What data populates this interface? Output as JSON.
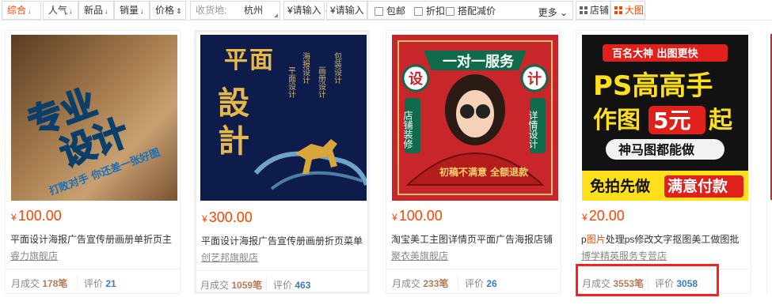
{
  "toolbar": {
    "sorts": [
      {
        "label": "综合",
        "arrow": "↓"
      },
      {
        "label": "人气",
        "arrow": "↓"
      },
      {
        "label": "新品",
        "arrow": "↓"
      },
      {
        "label": "销量",
        "arrow": "↓"
      },
      {
        "label": "价格",
        "arrow": "⇕"
      }
    ],
    "ship_label": "收货地:",
    "ship_city": "杭州",
    "price_min_placeholder": "¥请输入",
    "price_max_placeholder": "¥请输入",
    "price_dash": "-",
    "filters": [
      "包邮",
      "折扣",
      "搭配减价"
    ],
    "more_label": "更多 ⌄",
    "view_store": "店铺",
    "view_grid": "大图"
  },
  "products": [
    {
      "price": "100.00",
      "currency": "¥",
      "title": "平面设计海报广告宣传册画册单折页主",
      "title_highlight": "",
      "shop": "睿力旗舰店",
      "monthly_label": "月成交",
      "monthly": "178笔",
      "review_label": "评价",
      "reviews": "21",
      "art": {
        "line1": "专业",
        "line2": "设计",
        "tag": "打败对手 你还差一张好图"
      }
    },
    {
      "price": "300.00",
      "currency": "¥",
      "title": "平面设计海报广告宣传册画册折页菜单",
      "title_highlight": "",
      "shop": "创艺邦旗舰店",
      "monthly_label": "月成交",
      "monthly": "1059笔",
      "review_label": "评价",
      "reviews": "463",
      "art": {
        "big1": "平",
        "big2": "面",
        "big3": "設",
        "big4": "計",
        "c1": "平面设计",
        "c2": "海报设计",
        "c3": "画册设计",
        "c4": "包装设计"
      }
    },
    {
      "price": "100.00",
      "currency": "¥",
      "title": "淘宝美工主图详情页平面广告海报店铺",
      "title_highlight": "",
      "shop": "聚衣美旗舰店",
      "monthly_label": "月成交",
      "monthly": "233笔",
      "review_label": "评价",
      "reviews": "26",
      "art": {
        "banner": "一对一服务",
        "l1": "设",
        "r1": "计",
        "lv": "店铺装修",
        "rv": "详情设计",
        "fan": "初稿不满意 全额退款"
      }
    },
    {
      "price": "20.00",
      "currency": "¥",
      "title_pre": "p",
      "title_highlight": "图片",
      "title_post": "处理ps修改文字抠图美工做图批",
      "shop": "博学精英服务专营店",
      "monthly_label": "月成交",
      "monthly": "3553笔",
      "review_label": "评价",
      "reviews": "3058",
      "art": {
        "top": "百名大神 出图更快",
        "h1": "PS高高手",
        "h2a": "作图",
        "h2b": "5元",
        "h2c": "起",
        "sub": "神马图都能做",
        "b1": "免拍先做",
        "b2": "满意付款"
      }
    }
  ],
  "colors": {
    "accent": "#ff4400",
    "highlight_box": "#ff1e1e",
    "monthly_num": "#b57c5b",
    "review_num": "#3d7bbd"
  }
}
